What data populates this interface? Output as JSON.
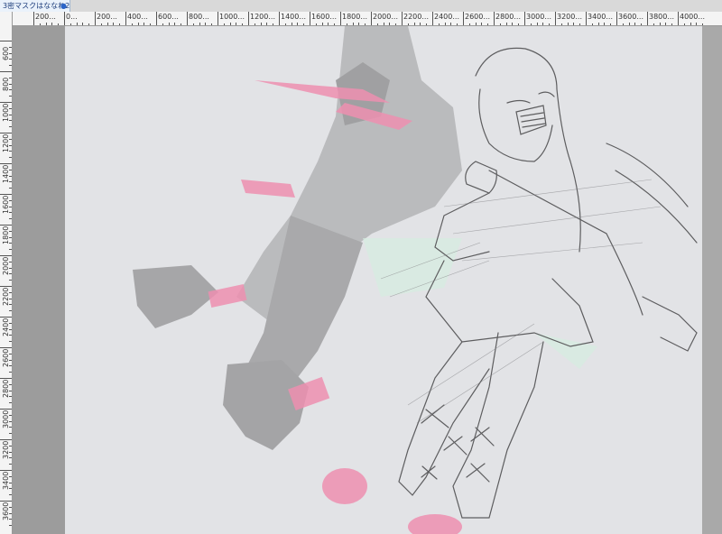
{
  "document": {
    "tab_title": "3密マスクはななね2*",
    "close_symbol": "●"
  },
  "ruler": {
    "top_labels": [
      "200",
      "0",
      "200",
      "400",
      "600",
      "800",
      "1000",
      "1200",
      "1400",
      "1600",
      "1800",
      "2000",
      "2200",
      "2400",
      "2600",
      "2800",
      "3000",
      "3200",
      "3400",
      "3600",
      "3800",
      "4000"
    ],
    "left_labels": [
      "600",
      "800",
      "1000",
      "1200",
      "1400",
      "1600",
      "1800",
      "2000",
      "2200",
      "2400",
      "2600",
      "2800",
      "3000",
      "3200",
      "3400",
      "3600"
    ]
  },
  "colors": {
    "canvas": "#e2e3e6",
    "workspace": "#9c9c9c",
    "shadow_figure": "#b9b9bb",
    "pink_accent": "#ef7fa4",
    "line_art": "#5a5a5a"
  },
  "canvas": {
    "artwork_icon": "sketch-illustration"
  }
}
